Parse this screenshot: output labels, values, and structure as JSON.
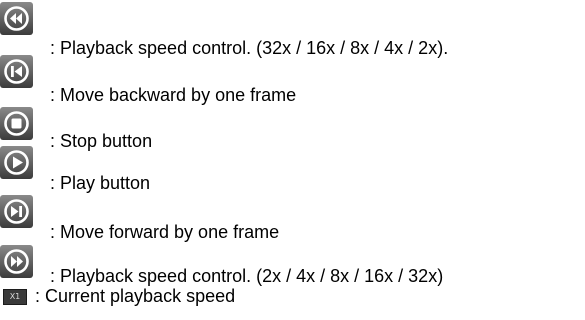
{
  "heading_fragment": "",
  "legend": {
    "items": [
      {
        "icon": "rewind-speed-icon",
        "text": ": Playback speed control. (32x / 16x / 8x / 4x / 2x)."
      },
      {
        "icon": "frame-backward-icon",
        "text": ": Move backward by one frame"
      },
      {
        "icon": "stop-icon",
        "text": ": Stop button"
      },
      {
        "icon": "play-icon",
        "text": ": Play button"
      },
      {
        "icon": "frame-forward-icon",
        "text": ": Move forward by one frame"
      },
      {
        "icon": "fast-forward-speed-icon",
        "text": ": Playback speed control. (2x / 4x / 8x / 16x / 32x)"
      },
      {
        "icon": "current-speed-badge",
        "badge": "X1",
        "text": ": Current playback speed"
      }
    ]
  },
  "colors": {
    "icon_bg": "#4a4a4a",
    "icon_glyph": "#ffffff",
    "badge_bg": "#3a3a3a"
  }
}
